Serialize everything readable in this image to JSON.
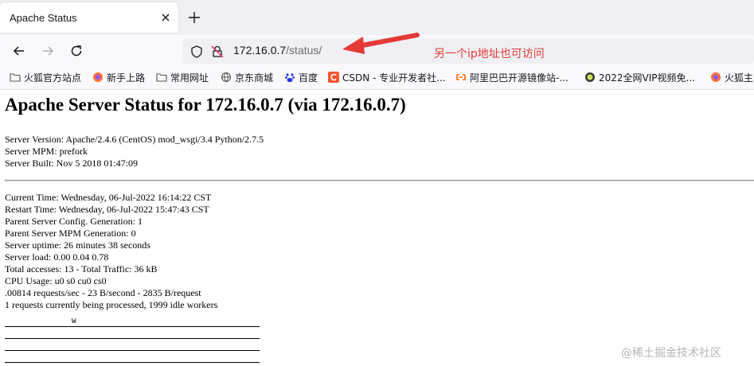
{
  "tab": {
    "title": "Apache Status"
  },
  "nav": {
    "url_host": "172.16.0.7",
    "url_path": "/status/",
    "annotation": "另一个ip地址也可访问"
  },
  "bookmarks": [
    {
      "label": "火狐官方站点",
      "icon": "folder-icon",
      "color": "#555555"
    },
    {
      "label": "新手上路",
      "icon": "firefox-icon",
      "color": "#ff7139"
    },
    {
      "label": "常用网址",
      "icon": "folder-icon",
      "color": "#555555"
    },
    {
      "label": "京东商城",
      "icon": "globe-icon",
      "color": "#555555"
    },
    {
      "label": "百度",
      "icon": "baidu-icon",
      "color": "#2932e1"
    },
    {
      "label": "CSDN - 专业开发者社...",
      "icon": "csdn-icon",
      "color": "#fc5531"
    },
    {
      "label": "阿里巴巴开源镜像站-...",
      "icon": "alibaba-icon",
      "color": "#ff6a00"
    },
    {
      "label": "2022全网VIP视频免...",
      "icon": "vip-icon",
      "color": "#8bc34a"
    },
    {
      "label": "火狐主",
      "icon": "firefox-icon",
      "color": "#ff7139"
    }
  ],
  "page": {
    "title": "Apache Server Status for 172.16.0.7 (via 172.16.0.7)",
    "server_info": [
      "Server Version: Apache/2.4.6 (CentOS) mod_wsgi/3.4 Python/2.7.5",
      "Server MPM: prefork",
      "Server Built: Nov 5 2018 01:47:09"
    ],
    "stats": [
      "Current Time: Wednesday, 06-Jul-2022 16:14:22 CST",
      "Restart Time: Wednesday, 06-Jul-2022 15:47:43 CST",
      "Parent Server Config. Generation: 1",
      "Parent Server MPM Generation: 0",
      "Server uptime: 26 minutes 38 seconds",
      "Server load: 0.00 0.04 0.78",
      "Total accesses: 13 - Total Traffic: 36 kB",
      "CPU Usage: u0 s0 cu0 cs0",
      ".00814 requests/sec - 23 B/second - 2835 B/request",
      "1 requests currently being processed, 1999 idle workers"
    ],
    "scoreboard_first": "W"
  },
  "watermark": "@稀土掘金技术社区",
  "colors": {
    "annotation": "#e53935",
    "tabstrip": "#f0f0f4",
    "toolbar": "#f9f9fb"
  }
}
